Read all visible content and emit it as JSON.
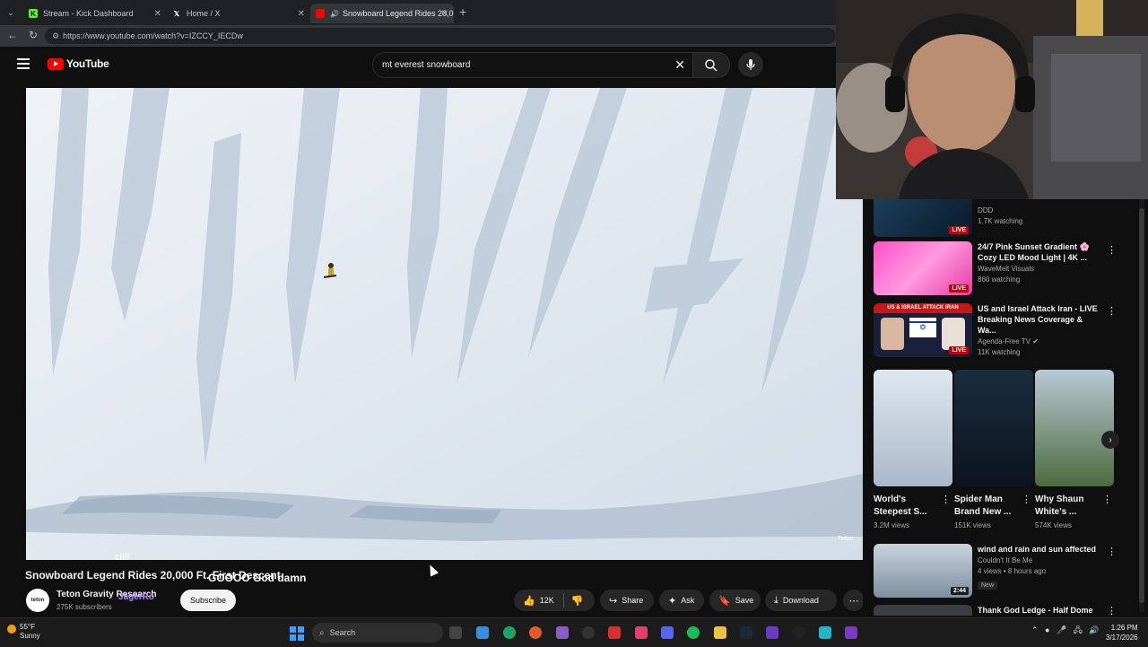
{
  "browser": {
    "tabs": [
      {
        "label": "Stream - Kick Dashboard",
        "icon": "kick-icon",
        "color": "#53fc18"
      },
      {
        "label": "Home / X",
        "icon": "x-icon",
        "color": "#ffffff"
      },
      {
        "label": "Snowboard Legend Rides 20,0",
        "icon": "youtube-icon",
        "color": "#ff0000"
      }
    ],
    "url": "https://www.youtube.com/watch?v=IZCCY_IECDw"
  },
  "youtube": {
    "logo_text": "YouTube",
    "search_query": "mt everest snowboard"
  },
  "video": {
    "watermark": "Teton",
    "caption": "cliff",
    "title": "Snowboard Legend Rides 20,000 Ft. First Descent",
    "overlay_chat": "GOOOO God damn",
    "channel_name": "Teton Gravity Research",
    "channel_subs": "275K subscribers",
    "chat_user": "JagerRo",
    "subscribe_label": "Subscribe",
    "actions": {
      "like_count": "12K",
      "share_label": "Share",
      "ask_label": "Ask",
      "save_label": "Save",
      "download_label": "Download"
    }
  },
  "sidebar": {
    "top_partial": {
      "channel": "DDD",
      "views": "1.7K watching",
      "live": "LIVE"
    },
    "items": [
      {
        "title": "24/7 Pink Sunset Gradient 🌸 Cozy LED Mood Light | 4K ...",
        "channel": "WaveMelt Visuals",
        "views": "860 watching",
        "badge": "LIVE"
      },
      {
        "title": "US and Israel Attack Iran - LIVE Breaking News Coverage & Wa...",
        "channel": "Agenda-Free TV",
        "views": "11K watching",
        "badge": "LIVE",
        "thumb_text": "US & ISRAEL ATTACK IRAN"
      }
    ],
    "shorts": [
      {
        "title": "World's Steepest S...",
        "views": "3.2M views"
      },
      {
        "title": "Spider Man Brand New ...",
        "views": "151K views"
      },
      {
        "title": "Why Shaun White's ...",
        "views": "574K views"
      }
    ],
    "item3": {
      "title": "wind and rain and sun affected",
      "channel": "Couldn't It Be Me",
      "views": "4 views • 8 hours ago",
      "badge": "New",
      "duration": "2:44"
    },
    "item4": {
      "title": "Thank God Ledge - Half Dome"
    }
  },
  "taskbar": {
    "temp": "55°F",
    "weather": "Sunny",
    "search_label": "Search",
    "time": "1:26 PM",
    "date": "3/17/2026"
  }
}
